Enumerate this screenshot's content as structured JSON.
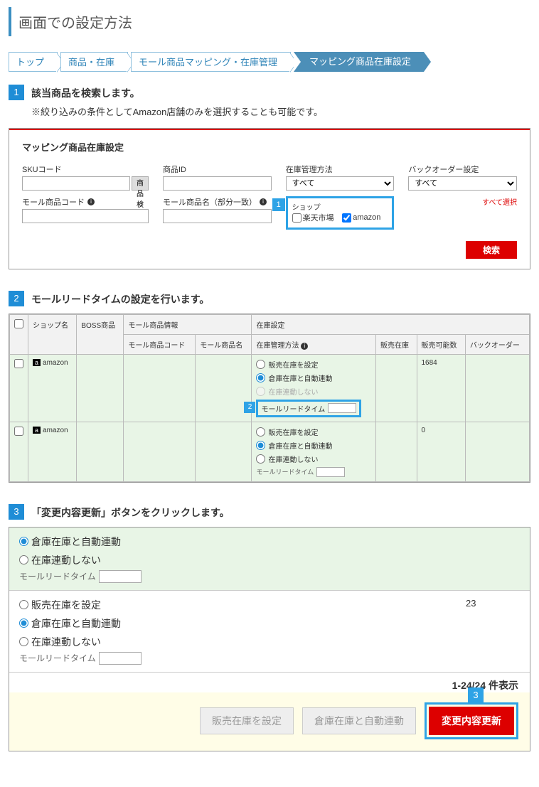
{
  "page": {
    "title": "画面での設定方法"
  },
  "breadcrumb": {
    "items": [
      "トップ",
      "商品・在庫",
      "モール商品マッピング・在庫管理",
      "マッピング商品在庫設定"
    ]
  },
  "steps": {
    "s1": {
      "num": "1",
      "title": "該当商品を検索します。",
      "note": "※絞り込みの条件としてAmazon店舗のみを選択することも可能です。"
    },
    "s2": {
      "num": "2",
      "title": "モールリードタイムの設定を行います。"
    },
    "s3": {
      "num": "3",
      "title": "「変更内容更新」ボタンをクリックします。"
    }
  },
  "filter": {
    "panel_title": "マッピング商品在庫設定",
    "sku_label": "SKUコード",
    "find_btn": "商品検索",
    "product_id_label": "商品ID",
    "stock_method_label": "在庫管理方法",
    "stock_method_value": "すべて",
    "backorder_label": "バックオーダー設定",
    "backorder_value": "すべて",
    "mall_code_label": "モール商品コード",
    "mall_name_label": "モール商品名（部分一致）",
    "shop_label": "ショップ",
    "shop_rakuten": "楽天市場",
    "shop_amazon": "amazon",
    "select_all": "すべて選択",
    "search_btn": "検索",
    "callout_num": "1"
  },
  "table2": {
    "headers": {
      "check": "",
      "shop": "ショップ名",
      "boss": "BOSS商品",
      "mall_info": "モール商品情報",
      "mall_code": "モール商品コード",
      "mall_name": "モール商品名",
      "stock_settings": "在庫設定",
      "stock_method": "在庫管理方法",
      "sale_stock": "販売在庫",
      "available": "販売可能数",
      "backorder": "バックオーダー"
    },
    "radio_opts": {
      "set_sales": "販売在庫を設定",
      "auto_link": "倉庫在庫と自動連動",
      "no_link": "在庫連動しない"
    },
    "lead_label": "モールリードタイム",
    "rows": [
      {
        "shop": "amazon",
        "available": "1684",
        "selected": 1
      },
      {
        "shop": "amazon",
        "available": "0",
        "selected": 1
      }
    ],
    "callout_num": "2"
  },
  "panel3": {
    "row1_available": "",
    "row2_available": "23",
    "pager": "1-24/24 件表示",
    "btn_sales": "販売在庫を設定",
    "btn_auto": "倉庫在庫と自動連動",
    "btn_update": "変更内容更新",
    "callout_num": "3"
  }
}
